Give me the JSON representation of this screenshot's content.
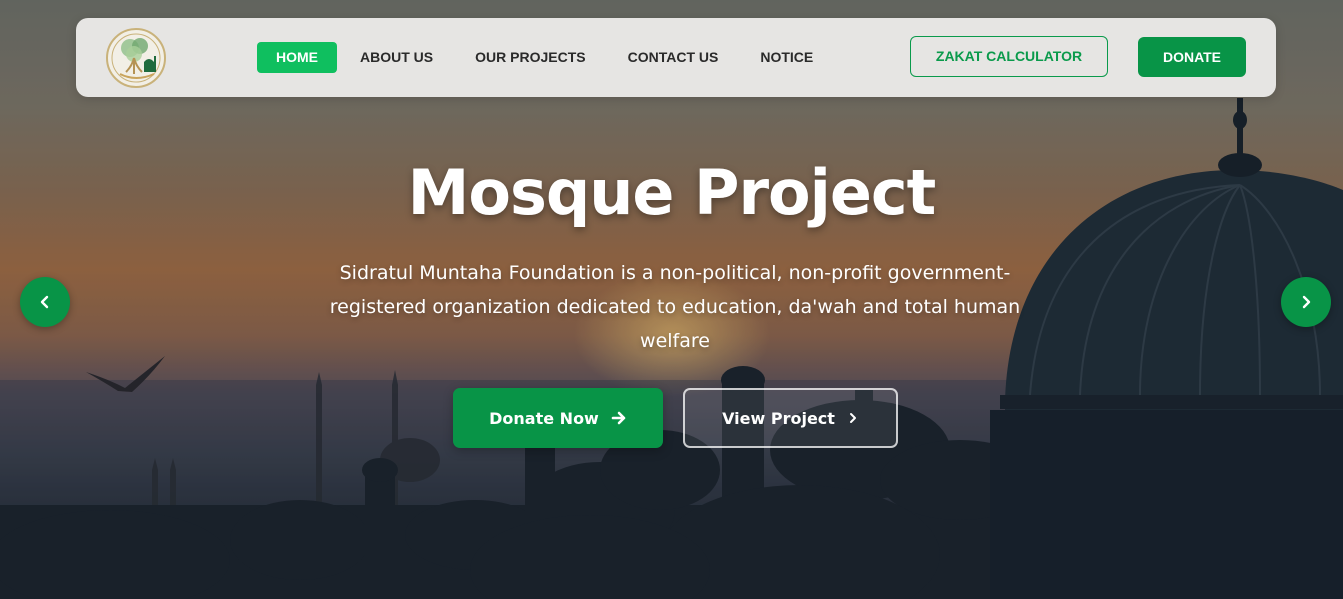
{
  "nav": {
    "logo_icon": "tree-mosque-logo-icon",
    "links": [
      {
        "label": "HOME",
        "active": true
      },
      {
        "label": "ABOUT US",
        "active": false
      },
      {
        "label": "OUR PROJECTS",
        "active": false
      },
      {
        "label": "CONTACT US",
        "active": false
      },
      {
        "label": "NOTICE",
        "active": false
      }
    ],
    "zakat_label": "ZAKAT CALCULATOR",
    "donate_label": "DONATE"
  },
  "hero": {
    "title": "Mosque Project",
    "description": "Sidratul Muntaha Foundation is a non-political, non-profit government-registered organization dedicated to education, da'wah and total human welfare",
    "primary_cta": {
      "label": "Donate Now",
      "icon": "arrow-right-icon"
    },
    "secondary_cta": {
      "label": "View Project",
      "icon": "chevron-right-icon"
    },
    "prev_icon": "chevron-left-icon",
    "next_icon": "chevron-right-icon"
  },
  "colors": {
    "accent": "#089447",
    "accent_light": "#0fbf5f",
    "nav_bg": "#e6e5e3"
  }
}
